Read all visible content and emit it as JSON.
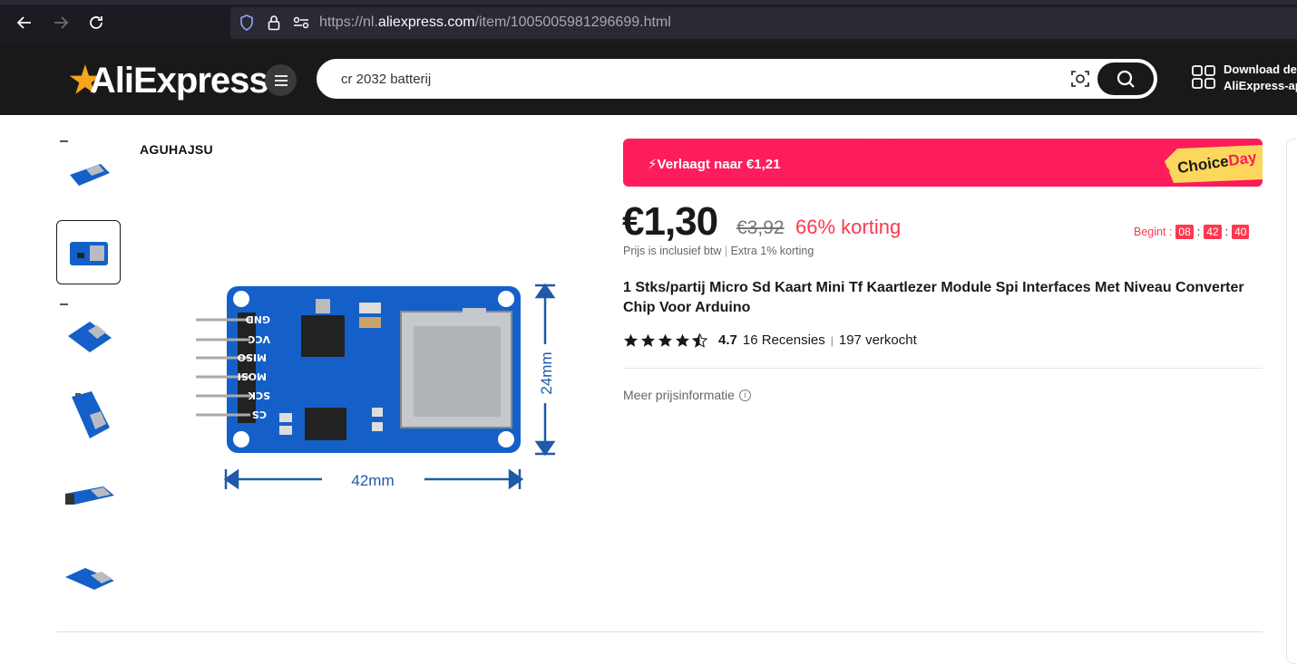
{
  "browser": {
    "url_prefix": "https://nl.",
    "url_domain": "aliexpress.com",
    "url_path": "/item/1005005981296699.html"
  },
  "header": {
    "logo": "AliExpress",
    "search_value": "cr 2032 batterij",
    "download_line1": "Download de",
    "download_line2": "AliExpress-ap"
  },
  "store": {
    "name": "AGUHAJSU"
  },
  "image": {
    "width_label": "42mm",
    "height_label": "24mm",
    "pins": [
      "GND",
      "VCC",
      "MISO",
      "MOSI",
      "SCK",
      "CS"
    ]
  },
  "promo": {
    "text": "Verlaagt naar €1,21",
    "choice": "Choice",
    "day": "Day"
  },
  "price": {
    "current": "€1,30",
    "original": "€3,92",
    "discount": "66% korting",
    "vat_note": "Prijs is inclusief btw",
    "extra_note": "Extra 1% korting"
  },
  "countdown": {
    "label": "Begint :",
    "hours": "08",
    "minutes": "42",
    "seconds": "40"
  },
  "product": {
    "title": "1 Stks/partij Micro Sd Kaart Mini Tf Kaartlezer Module Spi Interfaces Met Niveau Converter Chip Voor Arduino",
    "rating": "4.7",
    "reviews": "16 Recensies",
    "sold": "197 verkocht",
    "more_info": "Meer prijsinformatie"
  },
  "colors": {
    "accent": "#fd384f",
    "banner": "#fd1d5c",
    "header_bg": "#191919",
    "pcb_blue": "#1560c8"
  }
}
